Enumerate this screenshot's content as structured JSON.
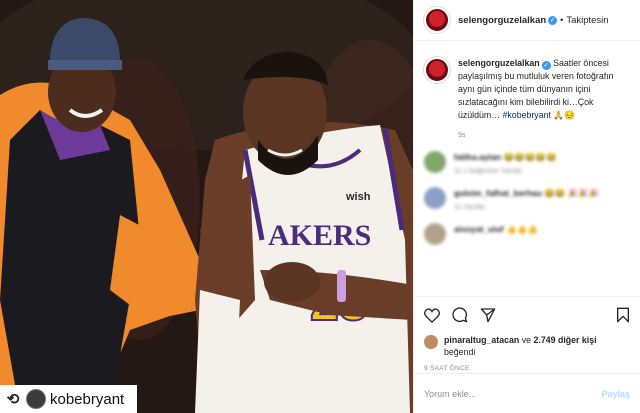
{
  "post": {
    "photo_alt": "",
    "repost": {
      "username": "kobebryant"
    }
  },
  "header": {
    "username": "selengorguzelalkan",
    "separator": "•",
    "follow_label": "Takiptesin"
  },
  "caption": {
    "username": "selengorguzelalkan",
    "text": "Saatler öncesi paylaşılmış bu mutluluk veren fotoğrafın aynı gün içinde tüm dünyanın içini sızlatacağını kim bilebilirdi ki…Çok üzüldüm…",
    "hashtag": "#kobebryant",
    "emojis": "🙏😔",
    "time": "9s"
  },
  "blurred_comments": [
    {
      "user": "fatiha.aytan",
      "text": "😂😂😂😂😂",
      "meta": "1s   1 beğenme   Yanıtla",
      "avatar_color": "#7fa86a"
    },
    {
      "user": "gulsim_falhat_berhau",
      "text": "😂😂 🎉🎉🎉",
      "meta": "1s   Yanıtla",
      "avatar_color": "#8aa0c8"
    },
    {
      "user": "aisoyat_uiuf",
      "text": "👍👍👍",
      "meta": "",
      "avatar_color": "#b3a28a"
    }
  ],
  "likes": {
    "user": "pinaraltug_atacan",
    "connector": "ve",
    "count": "2.749 diğer kişi",
    "suffix": "beğendi"
  },
  "posted_time": "9 SAAT ÖNCE",
  "comment_input": {
    "placeholder": "Yorum ekle..."
  },
  "post_button": "Paylaş",
  "colors": {
    "verified": "#3897f0",
    "link": "#00376b",
    "muted": "#8e8e8e"
  },
  "icons": [
    "heart-icon",
    "comment-icon",
    "share-icon",
    "bookmark-icon",
    "repost-icon",
    "verified-icon"
  ]
}
